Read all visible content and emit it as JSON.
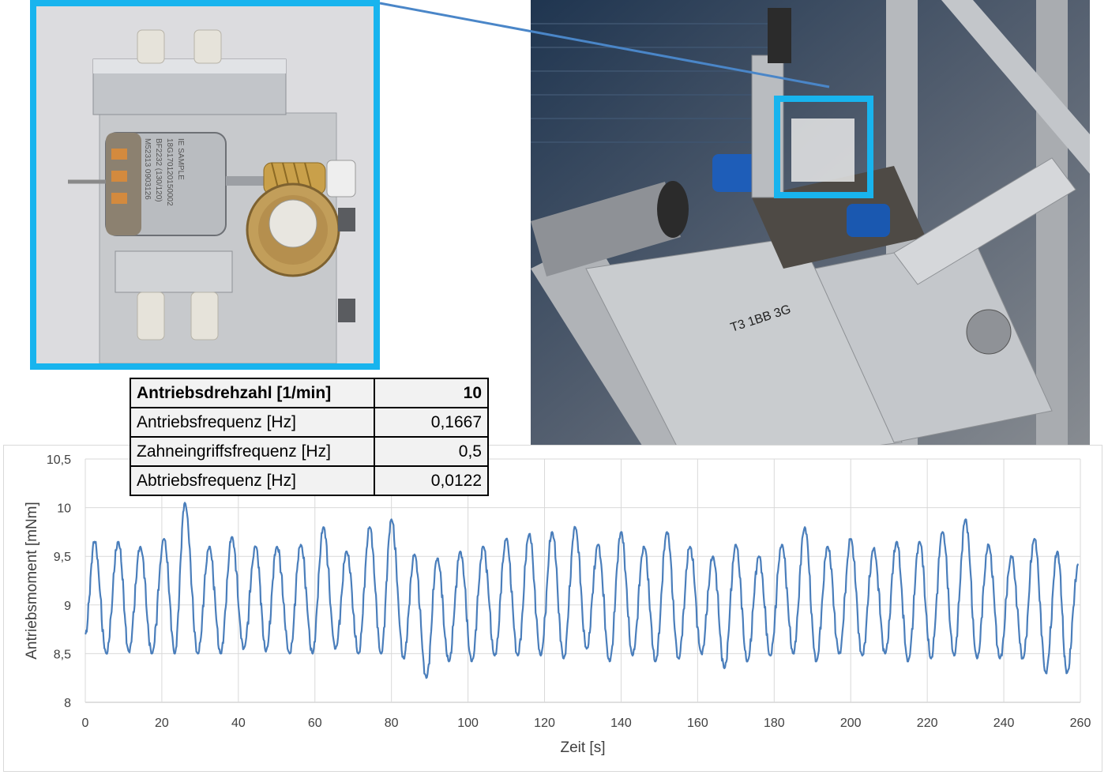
{
  "param_table": {
    "rows": [
      {
        "label": "Antriebsdrehzahl [1/min]",
        "value": "10"
      },
      {
        "label": "Antriebsfrequenz [Hz]",
        "value": "0,1667"
      },
      {
        "label": "Zahneingriffsfrequenz [Hz]",
        "value": "0,5"
      },
      {
        "label": "Abtriebsfrequenz [Hz]",
        "value": "0,0122"
      }
    ]
  },
  "inset_photo": {
    "label_lines": [
      "IE SAMPLE",
      "18G170120150002",
      "BF2232 (130/120)",
      "M52313 0903126"
    ],
    "highlight_color": "#18b4ee"
  },
  "rig_photo": {
    "marker_text": "T3 1BB 3G",
    "highlight_color": "#18b4ee"
  },
  "colors": {
    "series": "#4a7ebb",
    "grid": "#d9d9d9",
    "accent": "#18b4ee",
    "connector": "#4a86c8"
  },
  "chart_data": {
    "type": "line",
    "xlabel": "Zeit [s]",
    "ylabel": "Antriebsmoment  [mNm]",
    "xlim": [
      0,
      260
    ],
    "ylim": [
      8,
      10.5
    ],
    "x_ticks": [
      0,
      20,
      40,
      60,
      80,
      100,
      120,
      140,
      160,
      180,
      200,
      220,
      240,
      260
    ],
    "y_ticks": [
      8,
      8.5,
      9,
      9.5,
      10,
      10.5
    ],
    "y_tick_labels": [
      "8",
      "8,5",
      "9",
      "9,5",
      "10",
      "10,5"
    ],
    "grid": "horizontal and vertical",
    "legend": "none",
    "series": [
      {
        "period_s": 6,
        "peaks": [
          [
            2.4,
            9.65
          ],
          [
            8.6,
            9.65
          ],
          [
            14.4,
            9.6
          ],
          [
            20.6,
            9.68
          ],
          [
            26,
            10.05
          ],
          [
            32.4,
            9.6
          ],
          [
            38.3,
            9.7
          ],
          [
            44.5,
            9.6
          ],
          [
            50.1,
            9.6
          ],
          [
            56.3,
            9.62
          ],
          [
            62.2,
            9.8
          ],
          [
            68.3,
            9.55
          ],
          [
            74.3,
            9.8
          ],
          [
            80,
            9.88
          ],
          [
            86,
            9.52
          ],
          [
            92,
            9.48
          ],
          [
            98,
            9.55
          ],
          [
            104,
            9.6
          ],
          [
            110,
            9.68
          ],
          [
            116,
            9.73
          ],
          [
            122,
            9.75
          ],
          [
            128,
            9.8
          ],
          [
            134,
            9.62
          ],
          [
            140,
            9.75
          ],
          [
            146,
            9.6
          ],
          [
            152,
            9.75
          ],
          [
            158,
            9.6
          ],
          [
            164,
            9.5
          ],
          [
            170,
            9.62
          ],
          [
            176,
            9.5
          ],
          [
            182,
            9.62
          ],
          [
            188,
            9.8
          ],
          [
            194,
            9.6
          ],
          [
            200,
            9.68
          ],
          [
            206,
            9.58
          ],
          [
            212,
            9.65
          ],
          [
            218,
            9.65
          ],
          [
            224,
            9.75
          ],
          [
            230,
            9.88
          ],
          [
            236,
            9.62
          ],
          [
            242,
            9.5
          ],
          [
            248,
            9.68
          ],
          [
            254,
            9.55
          ],
          [
            259.5,
            9.42
          ]
        ],
        "troughs": [
          [
            0,
            8.7
          ],
          [
            5.5,
            8.5
          ],
          [
            11.4,
            8.52
          ],
          [
            17.4,
            8.5
          ],
          [
            23.4,
            8.5
          ],
          [
            29.4,
            8.5
          ],
          [
            35.4,
            8.5
          ],
          [
            41.4,
            8.55
          ],
          [
            47.2,
            8.52
          ],
          [
            53.4,
            8.5
          ],
          [
            59.4,
            8.5
          ],
          [
            65.4,
            8.55
          ],
          [
            71.4,
            8.5
          ],
          [
            77.3,
            8.5
          ],
          [
            83.2,
            8.45
          ],
          [
            89.1,
            8.25
          ],
          [
            95,
            8.42
          ],
          [
            101,
            8.42
          ],
          [
            107,
            8.48
          ],
          [
            113,
            8.48
          ],
          [
            119,
            8.48
          ],
          [
            125,
            8.45
          ],
          [
            131,
            8.55
          ],
          [
            137,
            8.42
          ],
          [
            143,
            8.48
          ],
          [
            149,
            8.42
          ],
          [
            155,
            8.45
          ],
          [
            161,
            8.5
          ],
          [
            167,
            8.35
          ],
          [
            173,
            8.42
          ],
          [
            179,
            8.48
          ],
          [
            185,
            8.5
          ],
          [
            191,
            8.42
          ],
          [
            197,
            8.5
          ],
          [
            203,
            8.48
          ],
          [
            209,
            8.5
          ],
          [
            215,
            8.42
          ],
          [
            221,
            8.45
          ],
          [
            227,
            8.48
          ],
          [
            233,
            8.45
          ],
          [
            239,
            8.45
          ],
          [
            245,
            8.45
          ],
          [
            251,
            8.3
          ],
          [
            256.5,
            8.3
          ]
        ]
      }
    ]
  }
}
